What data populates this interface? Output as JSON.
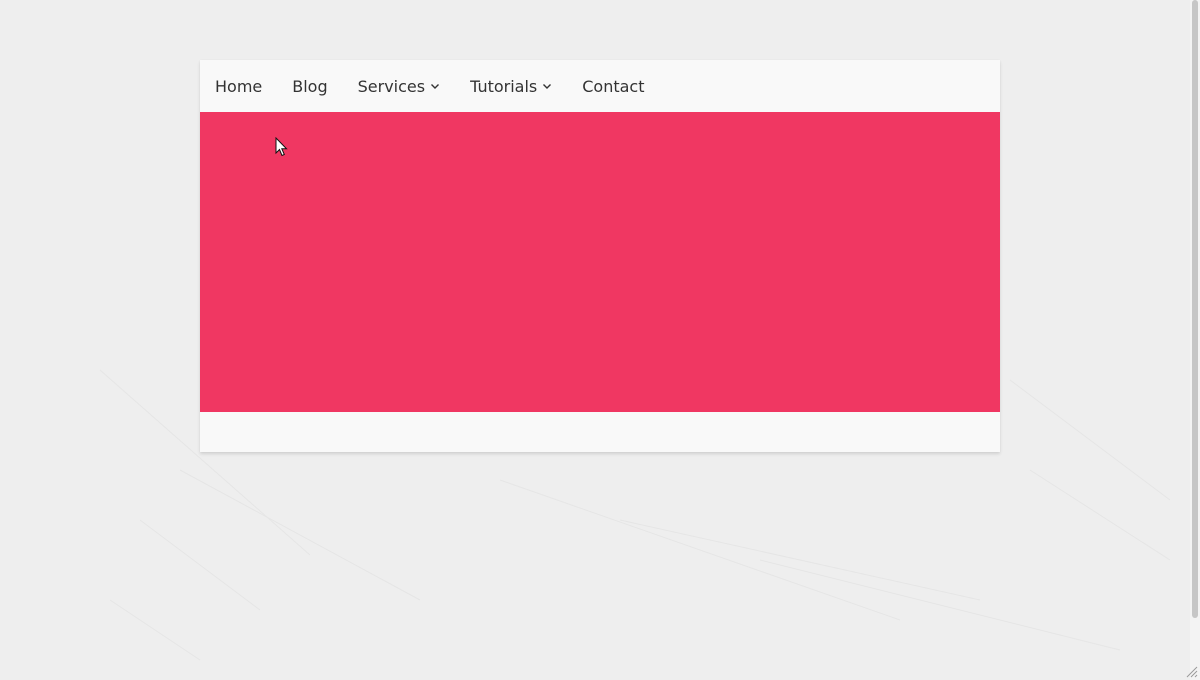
{
  "nav": {
    "items": [
      {
        "label": "Home",
        "has_dropdown": false
      },
      {
        "label": "Blog",
        "has_dropdown": false
      },
      {
        "label": "Services",
        "has_dropdown": true
      },
      {
        "label": "Tutorials",
        "has_dropdown": true
      },
      {
        "label": "Contact",
        "has_dropdown": false
      }
    ]
  },
  "hero": {
    "background_color": "#f03762"
  },
  "colors": {
    "page_background": "#eeeeee",
    "card_background": "#f9f9f9",
    "nav_text": "#333333"
  },
  "icons": {
    "dropdown": "chevron-down-icon",
    "pointer": "mouse-cursor-icon",
    "resize": "resize-grip-icon"
  }
}
